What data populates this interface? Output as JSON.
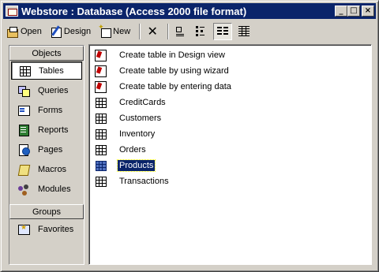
{
  "window": {
    "title": "Webstore : Database (Access 2000 file format)",
    "minimize_glyph": "_",
    "maximize_glyph": "□",
    "close_glyph": "×"
  },
  "toolbar": {
    "open_label": "Open",
    "design_label": "Design",
    "new_label": "New",
    "delete_glyph": "✕"
  },
  "objects_bar": {
    "objects_header": "Objects",
    "groups_header": "Groups",
    "items": [
      {
        "label": "Tables",
        "icon": "table-icon",
        "selected": true
      },
      {
        "label": "Queries",
        "icon": "query-icon"
      },
      {
        "label": "Forms",
        "icon": "form-icon"
      },
      {
        "label": "Reports",
        "icon": "report-icon"
      },
      {
        "label": "Pages",
        "icon": "page-icon"
      },
      {
        "label": "Macros",
        "icon": "macro-icon"
      },
      {
        "label": "Modules",
        "icon": "module-icon"
      }
    ],
    "groups": [
      {
        "label": "Favorites",
        "icon": "favorites-icon"
      }
    ]
  },
  "list": {
    "items": [
      {
        "label": "Create table in Design view",
        "icon": "shortcut-icon"
      },
      {
        "label": "Create table by using wizard",
        "icon": "shortcut-icon"
      },
      {
        "label": "Create table by entering data",
        "icon": "shortcut-icon"
      },
      {
        "label": "CreditCards",
        "icon": "table-icon"
      },
      {
        "label": "Customers",
        "icon": "table-icon"
      },
      {
        "label": "Inventory",
        "icon": "table-icon"
      },
      {
        "label": "Orders",
        "icon": "table-icon"
      },
      {
        "label": "Products",
        "icon": "table-icon",
        "selected": true
      },
      {
        "label": "Transactions",
        "icon": "table-icon"
      }
    ]
  },
  "colors": {
    "title_bar": "#0a246a",
    "face": "#d4d0c8",
    "selection": "#0a246a"
  }
}
